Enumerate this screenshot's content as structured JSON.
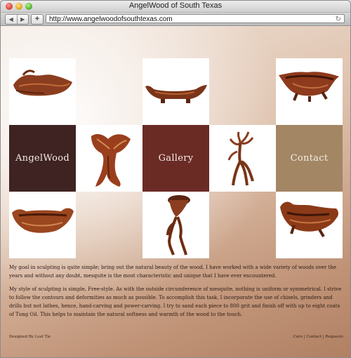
{
  "window": {
    "title": "AngelWood of South Texas"
  },
  "toolbar": {
    "url": "http://www.angelwoodofsouthtexas.com",
    "add_label": "+"
  },
  "nav": {
    "angelwood": "AngelWood",
    "gallery": "Gallery",
    "contact": "Contact"
  },
  "content": {
    "para1": "My goal in sculpting is quite simple; bring out the natural beauty of the wood. I have worked with a wide variety of woods over the years and without any doubt, mesquite is the most characteristic and unique that I have ever encountered.",
    "para2": "My style of sculpting is simple, Free-style. As with the outside circumference of mesquite, nothing is uniform or symmetrical. I strive to follow the contours and deformities as much as possible. To accomplish this task, I incorporate the use of chisels, grinders and drills but not lathes, hence, hand-carving and power-carving. I try to sand each piece to 800 grit and finish off with up to eight coats of Tung Oil. This helps to maintain the natural softness and warmth of the wood to the touch."
  },
  "footer": {
    "designed_by": "Designed By Lost Tie",
    "care": "Care",
    "contact": "Contact",
    "requests": "Requests",
    "separator": " | "
  }
}
